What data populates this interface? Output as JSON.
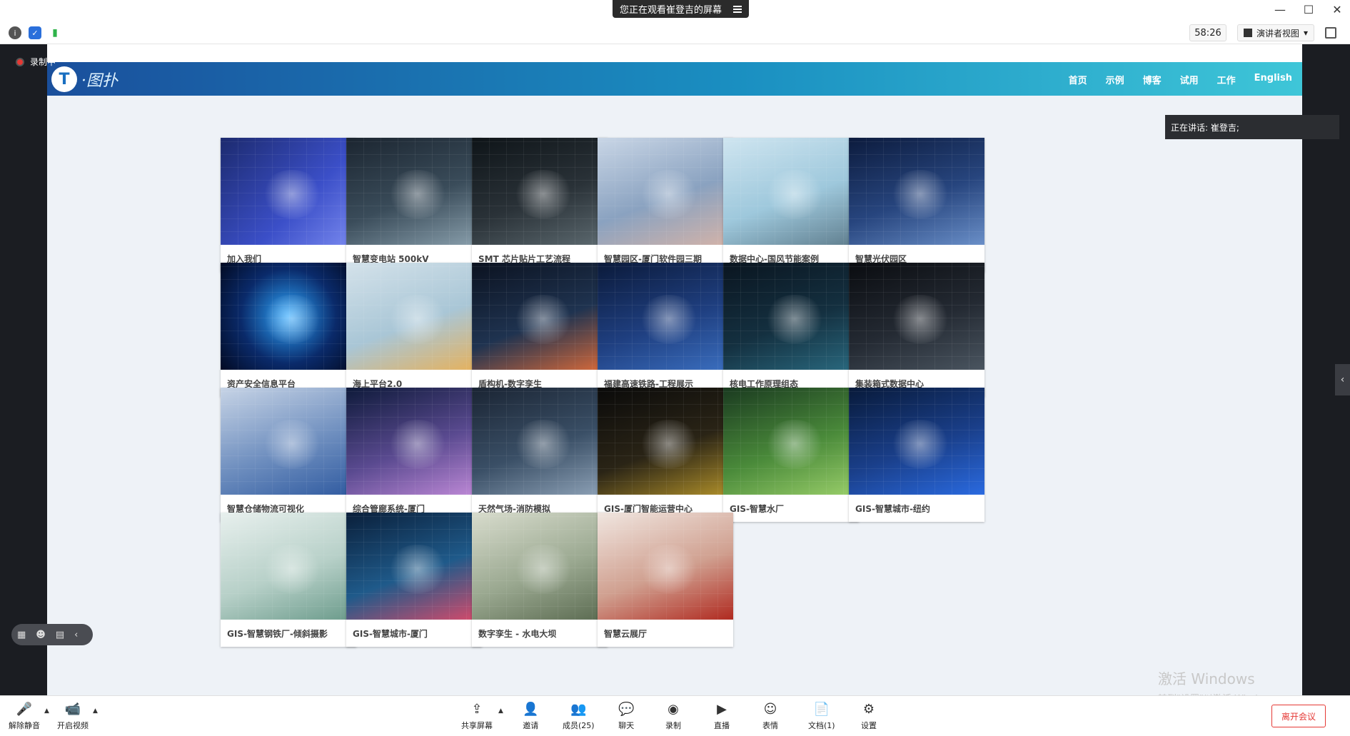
{
  "window": {
    "viewing_banner": "您正在观看崔登吉的屏幕",
    "controls": [
      "—",
      "☐",
      "✕"
    ]
  },
  "toolbar": {
    "timer": "58:26",
    "view_mode": "演讲者视图"
  },
  "recording": {
    "label": "录制中"
  },
  "speaking": {
    "text": "正在讲话: 崔登吉;"
  },
  "site": {
    "logo_text": "·图扑",
    "nav": [
      "首页",
      "示例",
      "博客",
      "试用",
      "工作",
      "English"
    ],
    "cards": [
      {
        "title": "加入我们",
        "bg": "linear-gradient(135deg,#1c2a6e,#3b4fc8 60%,#7a8af0)"
      },
      {
        "title": "智慧变电站 500kV",
        "bg": "linear-gradient(160deg,#1b2530,#3a4c5a 55%,#8aa0ad)"
      },
      {
        "title": "SMT 芯片贴片工艺流程",
        "bg": "linear-gradient(160deg,#0e1418,#2a3238 55%,#5d6a70)"
      },
      {
        "title": "智慧园区-厦门软件园三期",
        "bg": "linear-gradient(160deg,#c9d6e6,#8aa2c0 55%,#d4b3a8)"
      },
      {
        "title": "数据中心-国风节能案例",
        "bg": "linear-gradient(160deg,#cfe5f0,#9ec8dc 55%,#5f7d8d)"
      },
      {
        "title": "智慧光伏园区",
        "bg": "linear-gradient(160deg,#0c1b3d,#27457e 55%,#6a8fc8)"
      },
      {
        "title": "资产安全信息平台",
        "bg": "radial-gradient(circle at 50% 50%,#2ea8ff,#0a2a6a 55%,#020a22)"
      },
      {
        "title": "海上平台2.0",
        "bg": "linear-gradient(160deg,#d4e2ea,#a9c6d6 55%,#e7b15a)"
      },
      {
        "title": "盾构机-数字孪生",
        "bg": "linear-gradient(160deg,#0b1220,#1f3350 55%,#d86a3a)"
      },
      {
        "title": "福建高速铁路-工程展示",
        "bg": "linear-gradient(160deg,#0b1a3a,#1f3f80 55%,#3b6fc0)"
      },
      {
        "title": "核电工作原理组态",
        "bg": "linear-gradient(160deg,#0a1520,#143040 55%,#2a6a80)"
      },
      {
        "title": "集装箱式数据中心",
        "bg": "linear-gradient(160deg,#0a0c10,#242a33 55%,#4a5560)"
      },
      {
        "title": "智慧仓储物流可视化",
        "bg": "linear-gradient(160deg,#c7d4e6,#6f8fbf 55%,#2f5aa0)"
      },
      {
        "title": "综合管廊系统-厦门",
        "bg": "linear-gradient(160deg,#0e1a3a,#5a4a90 55%,#c08ad8)"
      },
      {
        "title": "天然气场-消防模拟",
        "bg": "linear-gradient(160deg,#1a2433,#3a4f66 55%,#8fa3b8)"
      },
      {
        "title": "GIS-厦门智能运营中心",
        "bg": "linear-gradient(160deg,#0a0a0a,#2a2416 55%,#b0902a)"
      },
      {
        "title": "GIS-智慧水厂",
        "bg": "linear-gradient(160deg,#1a3a20,#4a8a3a 55%,#9acf6a)"
      },
      {
        "title": "GIS-智慧城市-纽约",
        "bg": "linear-gradient(160deg,#081a3a,#1a3f8a 55%,#2a6ae0)"
      },
      {
        "title": "GIS-智慧钢铁厂-倾斜摄影",
        "bg": "linear-gradient(160deg,#e8f0ee,#b7d0c8 55%,#6a9a8a)"
      },
      {
        "title": "GIS-智慧城市-厦门",
        "bg": "linear-gradient(160deg,#0a1f3a,#1f5a8a 55%,#d84a6a)"
      },
      {
        "title": "数字孪生 - 水电大坝",
        "bg": "linear-gradient(160deg,#d8dccd,#9aa890 55%,#5a6a50)"
      },
      {
        "title": "智慧云展厅",
        "bg": "linear-gradient(160deg,#f0e6e0,#d0a090 55%,#b02a20)"
      }
    ]
  },
  "watermark": {
    "line1": "激活 Windows",
    "line2": "转到\"设置\"以激活 Windows。"
  },
  "bottom": {
    "items": [
      {
        "label": "解除静音",
        "icon": "mic-muted-icon",
        "glyph": "🎤"
      },
      {
        "label": "开启视频",
        "icon": "camera-off-icon",
        "glyph": "📹"
      },
      {
        "label": "共享屏幕",
        "icon": "share-screen-icon",
        "glyph": "⇪"
      },
      {
        "label": "邀请",
        "icon": "invite-icon",
        "glyph": "👤"
      },
      {
        "label": "成员(25)",
        "icon": "members-icon",
        "glyph": "👥"
      },
      {
        "label": "聊天",
        "icon": "chat-icon",
        "glyph": "💬"
      },
      {
        "label": "录制",
        "icon": "record-icon",
        "glyph": "◉"
      },
      {
        "label": "直播",
        "icon": "live-icon",
        "glyph": "▶"
      },
      {
        "label": "表情",
        "icon": "emoji-icon",
        "glyph": "☺"
      },
      {
        "label": "文档(1)",
        "icon": "document-icon",
        "glyph": "📄"
      },
      {
        "label": "设置",
        "icon": "settings-icon",
        "glyph": "⚙"
      }
    ],
    "leave": "离开会议"
  }
}
